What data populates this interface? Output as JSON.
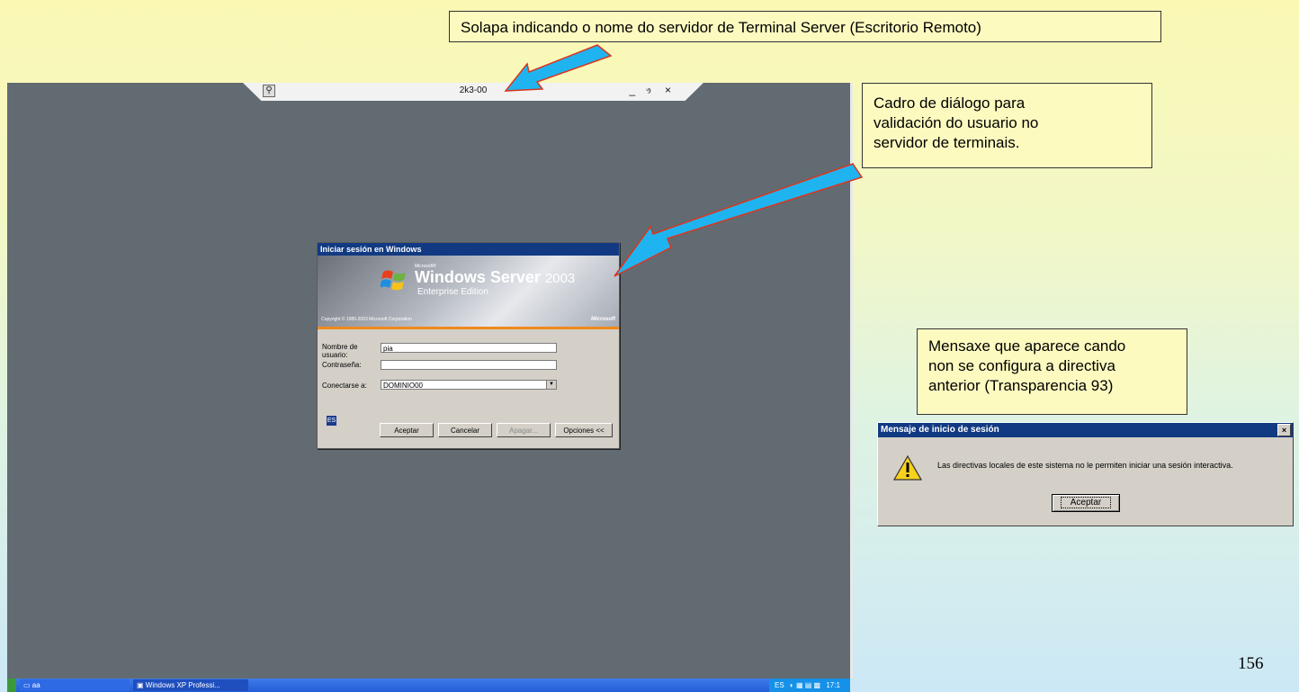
{
  "callouts": {
    "top": "Solapa indicando o nome do servidor de Terminal Server (Escritorio Remoto)",
    "right_lines": [
      "Cadro de diálogo para",
      "validación do usuario no",
      "servidor de terminais."
    ],
    "mid_lines": [
      "Mensaxe que aparece cando",
      "non se configura a directiva",
      "anterior (Transparencia 93)"
    ]
  },
  "rdp_tab": {
    "server_name": "2k3-00",
    "controls": "_ ෟ ×"
  },
  "logon_dialog": {
    "title": "Iniciar sesión en Windows",
    "banner": {
      "microsoft_label": "Microsoft®",
      "product_name": "Windows Server",
      "product_version": "2003",
      "edition": "Enterprise Edition",
      "copyright": "Copyright © 1985-2003  Microsoft Corporation",
      "ms_logo": "Microsoft"
    },
    "username_label": "Nombre de usuario:",
    "username_value": "pia",
    "password_label": "Contraseña:",
    "password_value": "",
    "connect_label": "Conectarse a:",
    "connect_value": "DOMINIO00",
    "language": "ES",
    "buttons": {
      "accept": "Aceptar",
      "cancel": "Cancelar",
      "shutdown": "Apagar...",
      "options": "Opciones <<"
    }
  },
  "taskbar": {
    "tasks": [
      "aa",
      "Windows XP Professi..."
    ],
    "tray_lang": "ES",
    "tray_time": "17:1"
  },
  "warning_dialog": {
    "title": "Mensaje de inicio de sesión",
    "close": "×",
    "message": "Las directivas locales de este sistema no le permiten iniciar una sesión interactiva.",
    "ok": "Aceptar"
  },
  "page_number": "156",
  "colors": {
    "arrow": "#1fb4f0",
    "arrow_outline": "#d9361e",
    "remote_desktop": "#636b72",
    "dialog_title": "#123a82"
  }
}
